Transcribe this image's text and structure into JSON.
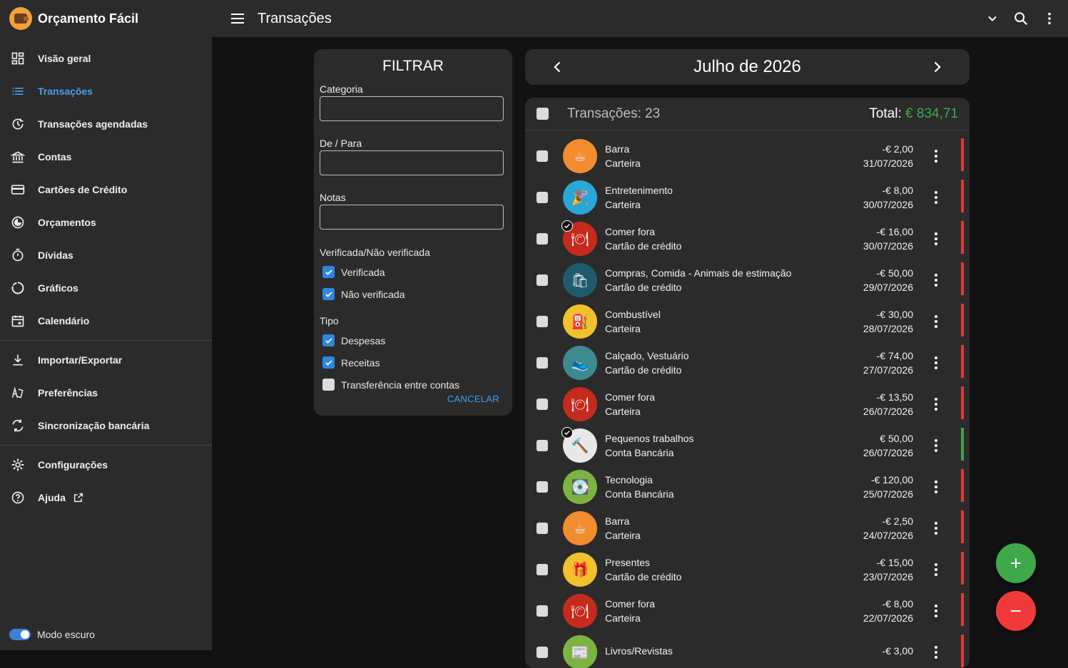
{
  "app": {
    "name": "Orçamento Fácil",
    "page_title": "Transações"
  },
  "sidebar": {
    "items": [
      {
        "label": "Visão geral",
        "icon": "dashboard-icon"
      },
      {
        "label": "Transações",
        "icon": "list-icon",
        "active": true
      },
      {
        "label": "Transações agendadas",
        "icon": "schedule-icon"
      },
      {
        "label": "Contas",
        "icon": "bank-icon"
      },
      {
        "label": "Cartões de Crédito",
        "icon": "credit-card-icon"
      },
      {
        "label": "Orçamentos",
        "icon": "budget-icon"
      },
      {
        "label": "Dívidas",
        "icon": "timer-icon"
      },
      {
        "label": "Gráficos",
        "icon": "chart-icon"
      },
      {
        "label": "Calendário",
        "icon": "calendar-icon"
      },
      {
        "label": "Importar/Exportar",
        "icon": "download-icon"
      },
      {
        "label": "Preferências",
        "icon": "preferences-icon"
      },
      {
        "label": "Sincronização bancária",
        "icon": "sync-icon"
      },
      {
        "label": "Configurações",
        "icon": "gear-icon"
      },
      {
        "label": "Ajuda",
        "icon": "help-icon"
      }
    ],
    "dark_mode_label": "Modo escuro"
  },
  "filter": {
    "title": "FILTRAR",
    "category_label": "Categoria",
    "from_to_label": "De / Para",
    "notes_label": "Notas",
    "verified_section": "Verificada/Não verificada",
    "verified": "Verificada",
    "unverified": "Não verificada",
    "type_section": "Tipo",
    "expenses": "Despesas",
    "income": "Receitas",
    "transfer": "Transferência entre contas",
    "cancel": "CANCELAR"
  },
  "month": {
    "label": "Julho de 2026"
  },
  "list": {
    "count_label": "Transações: 23",
    "total_label": "Total:",
    "total_amount": "€ 834,71",
    "rows": [
      {
        "cat": "Barra",
        "acc": "Carteira",
        "amt": "-€ 2,00",
        "date": "31/07/2026",
        "icon": "coffee-icon",
        "bg": "#f28c2e",
        "glyph": "☕",
        "bar": "#e53935",
        "checked": false
      },
      {
        "cat": "Entretenimento",
        "acc": "Carteira",
        "amt": "-€ 8,00",
        "date": "30/07/2026",
        "icon": "party-hat-icon",
        "bg": "#2aa7d6",
        "glyph": "🎉",
        "bar": "#e53935",
        "checked": false
      },
      {
        "cat": "Comer fora",
        "acc": "Cartão de crédito",
        "amt": "-€ 16,00",
        "date": "30/07/2026",
        "icon": "plate-icon",
        "bg": "#c52a1c",
        "glyph": "🍽",
        "bar": "#e53935",
        "checked": true
      },
      {
        "cat": "Compras, Comida - Animais de estimação",
        "acc": "Cartão de crédito",
        "amt": "-€ 50,00",
        "date": "29/07/2026",
        "icon": "shopping-bag-icon",
        "bg": "#1f5b6e",
        "glyph": "🛍",
        "bar": "#e53935",
        "checked": false
      },
      {
        "cat": "Combustível",
        "acc": "Carteira",
        "amt": "-€ 30,00",
        "date": "28/07/2026",
        "icon": "fuel-icon",
        "bg": "#f2c12e",
        "glyph": "⛽",
        "bar": "#e53935",
        "checked": false
      },
      {
        "cat": "Calçado, Vestuário",
        "acc": "Cartão de crédito",
        "amt": "-€ 74,00",
        "date": "27/07/2026",
        "icon": "shoe-icon",
        "bg": "#3d8b8e",
        "glyph": "👟",
        "bar": "#e53935",
        "checked": false
      },
      {
        "cat": "Comer fora",
        "acc": "Carteira",
        "amt": "-€ 13,50",
        "date": "26/07/2026",
        "icon": "plate-icon",
        "bg": "#c52a1c",
        "glyph": "🍽",
        "bar": "#e53935",
        "checked": false
      },
      {
        "cat": "Pequenos trabalhos",
        "acc": "Conta Bancária",
        "amt": "€ 50,00",
        "date": "26/07/2026",
        "icon": "tools-icon",
        "bg": "#e8e8e8",
        "glyph": "🔨",
        "bar": "#43a047",
        "checked": true
      },
      {
        "cat": "Tecnologia",
        "acc": "Conta Bancária",
        "amt": "-€ 120,00",
        "date": "25/07/2026",
        "icon": "hard-drive-icon",
        "bg": "#7cb342",
        "glyph": "💽",
        "bar": "#e53935",
        "checked": false
      },
      {
        "cat": "Barra",
        "acc": "Carteira",
        "amt": "-€ 2,50",
        "date": "24/07/2026",
        "icon": "coffee-icon",
        "bg": "#f28c2e",
        "glyph": "☕",
        "bar": "#e53935",
        "checked": false
      },
      {
        "cat": "Presentes",
        "acc": "Cartão de crédito",
        "amt": "-€ 15,00",
        "date": "23/07/2026",
        "icon": "gift-icon",
        "bg": "#f2c12e",
        "glyph": "🎁",
        "bar": "#e53935",
        "checked": false
      },
      {
        "cat": "Comer fora",
        "acc": "Carteira",
        "amt": "-€ 8,00",
        "date": "22/07/2026",
        "icon": "plate-icon",
        "bg": "#c52a1c",
        "glyph": "🍽",
        "bar": "#e53935",
        "checked": false
      },
      {
        "cat": "Livros/Revistas",
        "acc": "",
        "amt": "-€ 3,00",
        "date": "",
        "icon": "newspaper-icon",
        "bg": "#7cb342",
        "glyph": "📰",
        "bar": "#e53935",
        "checked": false
      }
    ]
  },
  "colors": {
    "accent": "#4a9fe8",
    "income": "#3fa84a",
    "expense": "#e53935"
  }
}
